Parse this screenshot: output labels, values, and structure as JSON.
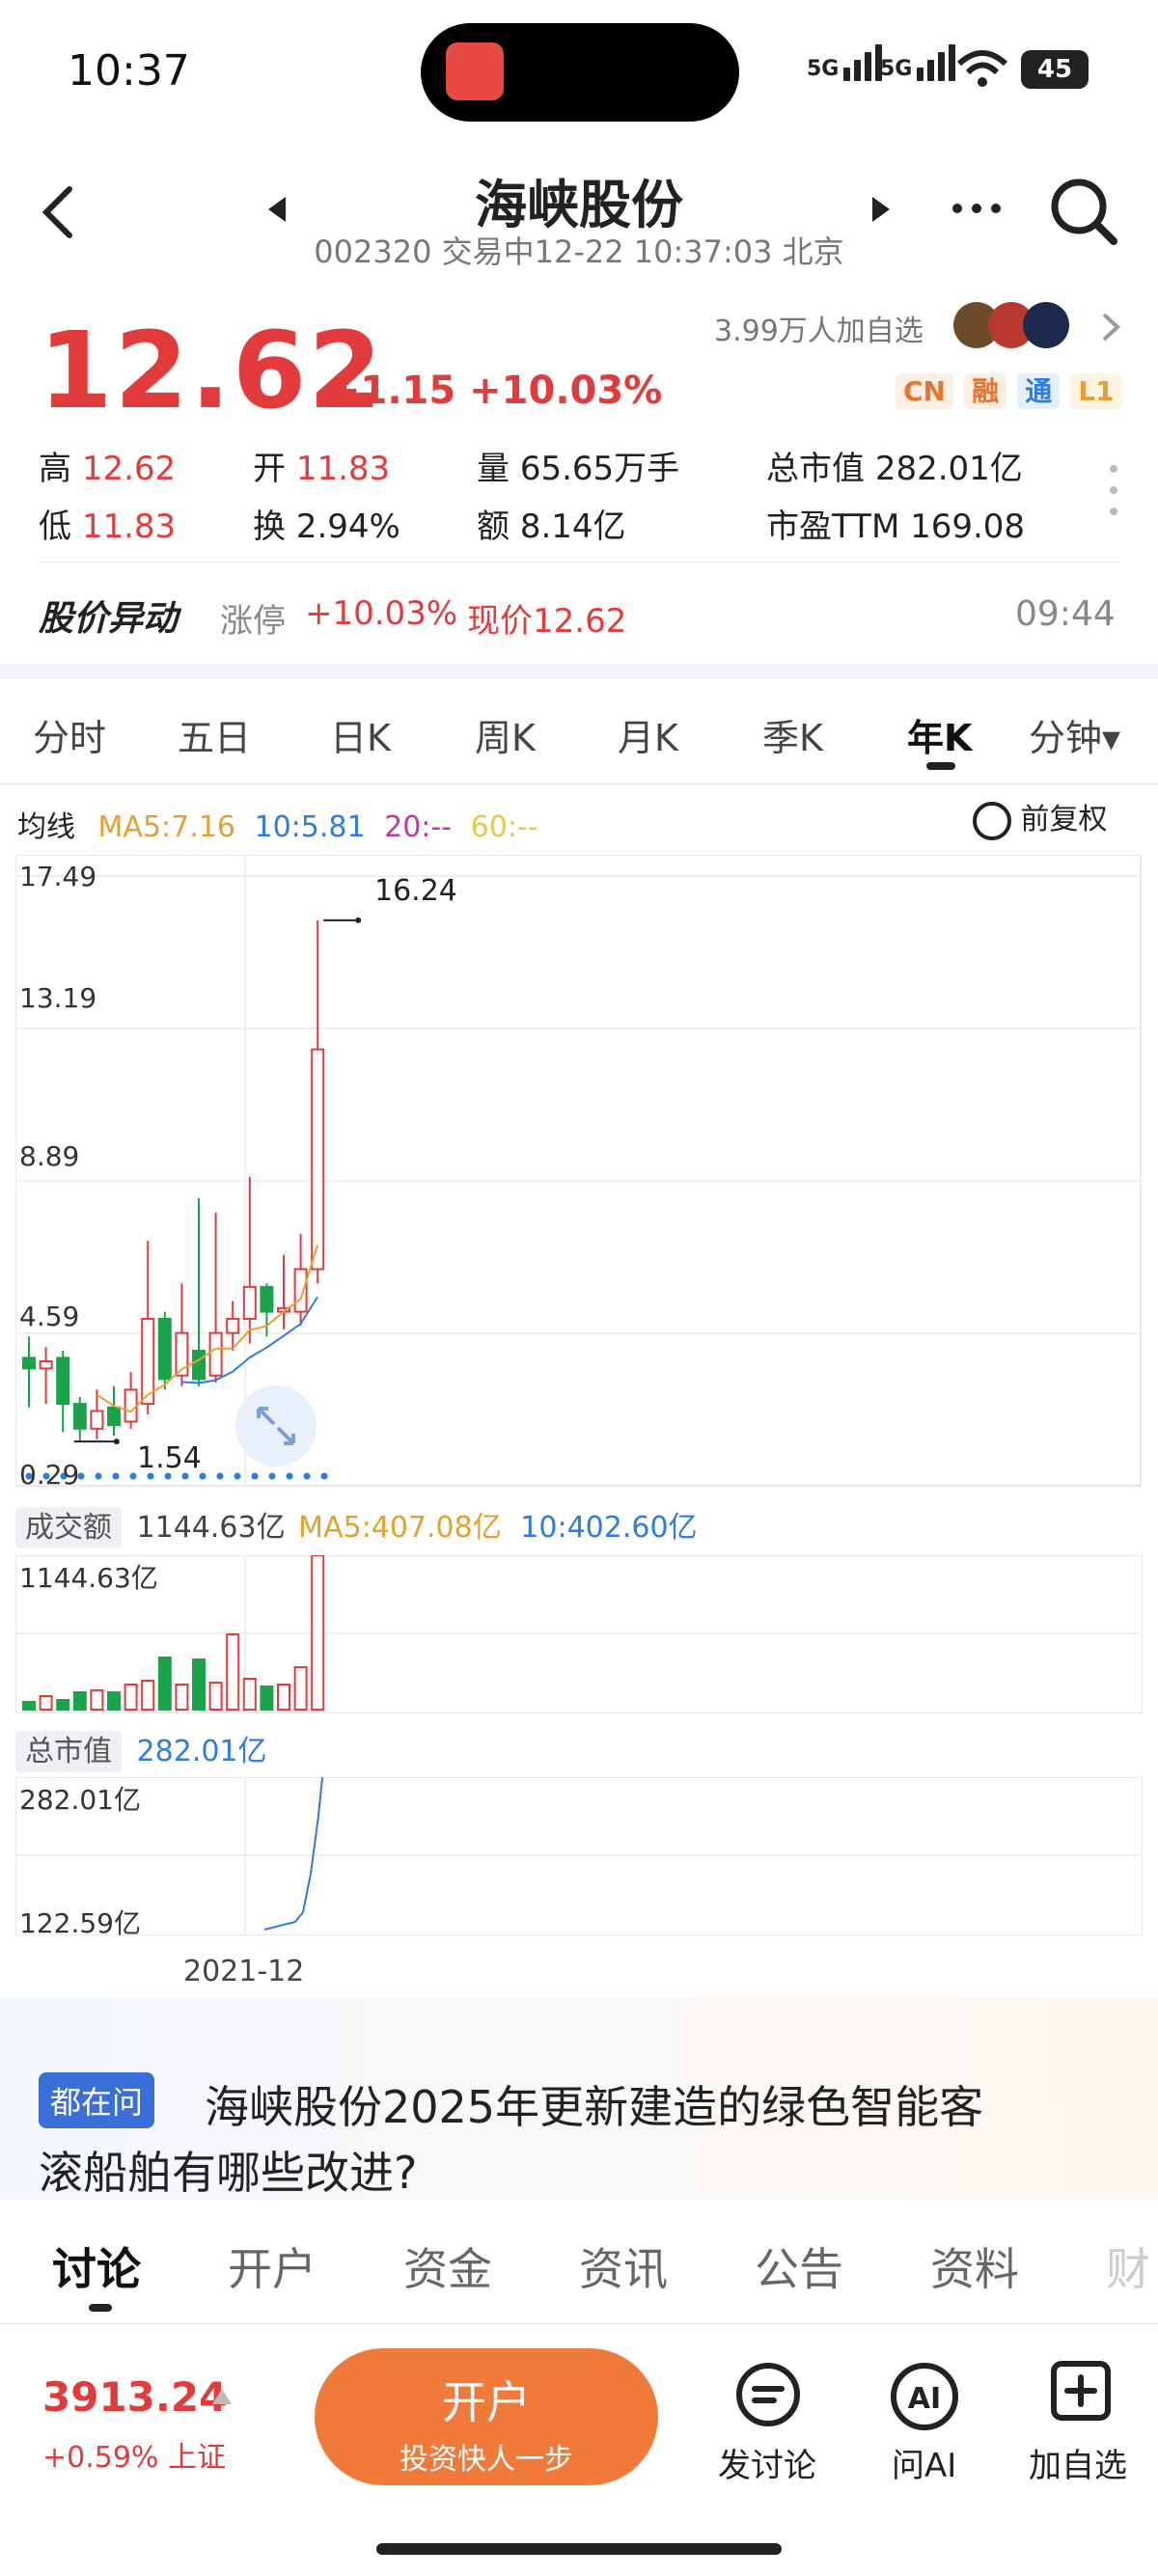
{
  "status": {
    "time": "10:37",
    "network1": "5G",
    "network2": "5G",
    "battery": "45"
  },
  "header": {
    "title": "海峡股份",
    "subtitle": "002320 交易中12-22 10:37:03 北京"
  },
  "quote": {
    "price": "12.62",
    "change": "+1.15 +10.03%",
    "watchers": "3.99万人加自选",
    "badges": [
      "CN",
      "融",
      "通",
      "L1"
    ],
    "high_label": "高",
    "high": "12.62",
    "open_label": "开",
    "open": "11.83",
    "volume_label": "量",
    "volume": "65.65万手",
    "mcap_label": "总市值",
    "mcap": "282.01亿",
    "low_label": "低",
    "low": "11.83",
    "turnover_label": "换",
    "turnover": "2.94%",
    "amount_label": "额",
    "amount": "8.14亿",
    "pe_label": "市盈TTM",
    "pe": "169.08"
  },
  "alert": {
    "title": "股价异动",
    "type": "涨停",
    "pct": "+10.03%",
    "now": "现价12.62",
    "time": "09:44"
  },
  "tabs": [
    "分时",
    "五日",
    "日K",
    "周K",
    "月K",
    "季K",
    "年K",
    "分钟▾"
  ],
  "ma": {
    "label": "均线",
    "ma5": "MA5:7.16",
    "ma10": "10:5.81",
    "ma20": "20:--",
    "ma60": "60:--",
    "adjust": "前复权"
  },
  "chart": {
    "y_ticks": [
      "17.49",
      "13.19",
      "8.89",
      "4.59",
      "0.29"
    ],
    "high_mark": "16.24",
    "low_mark": "1.54",
    "volume_label": "成交额",
    "volume_value": "1144.63亿",
    "volume_ma5": "MA5:407.08亿",
    "volume_ma10": "10:402.60亿",
    "volume_top": "1144.63亿",
    "mcap_label": "总市值",
    "mcap_value": "282.01亿",
    "mcap_top": "282.01亿",
    "mcap_bottom": "122.59亿",
    "x_label": "2021-12"
  },
  "chart_data": {
    "type": "candlestick",
    "ylim": [
      0.29,
      17.49
    ],
    "candles": [
      {
        "o": 3.9,
        "c": 3.6,
        "h": 4.5,
        "l": 2.5
      },
      {
        "o": 3.6,
        "c": 3.8,
        "h": 4.2,
        "l": 2.6
      },
      {
        "o": 3.9,
        "c": 2.6,
        "h": 4.1,
        "l": 1.8
      },
      {
        "o": 2.6,
        "c": 1.9,
        "h": 2.8,
        "l": 1.54
      },
      {
        "o": 1.9,
        "c": 2.4,
        "h": 3.0,
        "l": 1.6
      },
      {
        "o": 2.5,
        "c": 2.0,
        "h": 3.1,
        "l": 1.7
      },
      {
        "o": 2.1,
        "c": 3.0,
        "h": 3.5,
        "l": 1.9
      },
      {
        "o": 2.6,
        "c": 5.0,
        "h": 7.2,
        "l": 2.3
      },
      {
        "o": 5.0,
        "c": 3.3,
        "h": 5.2,
        "l": 3.0
      },
      {
        "o": 3.4,
        "c": 4.6,
        "h": 6.0,
        "l": 3.1
      },
      {
        "o": 4.1,
        "c": 3.3,
        "h": 8.4,
        "l": 3.1
      },
      {
        "o": 3.4,
        "c": 4.6,
        "h": 8.0,
        "l": 3.2
      },
      {
        "o": 4.6,
        "c": 5.0,
        "h": 5.5,
        "l": 4.1
      },
      {
        "o": 5.0,
        "c": 5.9,
        "h": 9.0,
        "l": 4.3
      },
      {
        "o": 5.9,
        "c": 5.2,
        "h": 6.0,
        "l": 4.5
      },
      {
        "o": 5.2,
        "c": 5.3,
        "h": 6.8,
        "l": 4.7
      },
      {
        "o": 5.2,
        "c": 6.4,
        "h": 7.4,
        "l": 4.8
      },
      {
        "o": 6.4,
        "c": 12.6,
        "h": 16.24,
        "l": 6.0
      }
    ]
  },
  "question": {
    "badge": "都在问",
    "text1": "海峡股份2025年更新建造的绿色智能客",
    "text2": "滚船舶有哪些改进?"
  },
  "bottom_tabs": [
    "讨论",
    "开户",
    "资金",
    "资讯",
    "公告",
    "资料",
    "财"
  ],
  "footer": {
    "index_value": "3913.24",
    "index_change": "+0.59% 上证",
    "open_title": "开户",
    "open_sub": "投资快人一步",
    "post": "发讨论",
    "ai": "问AI",
    "add": "加自选"
  }
}
